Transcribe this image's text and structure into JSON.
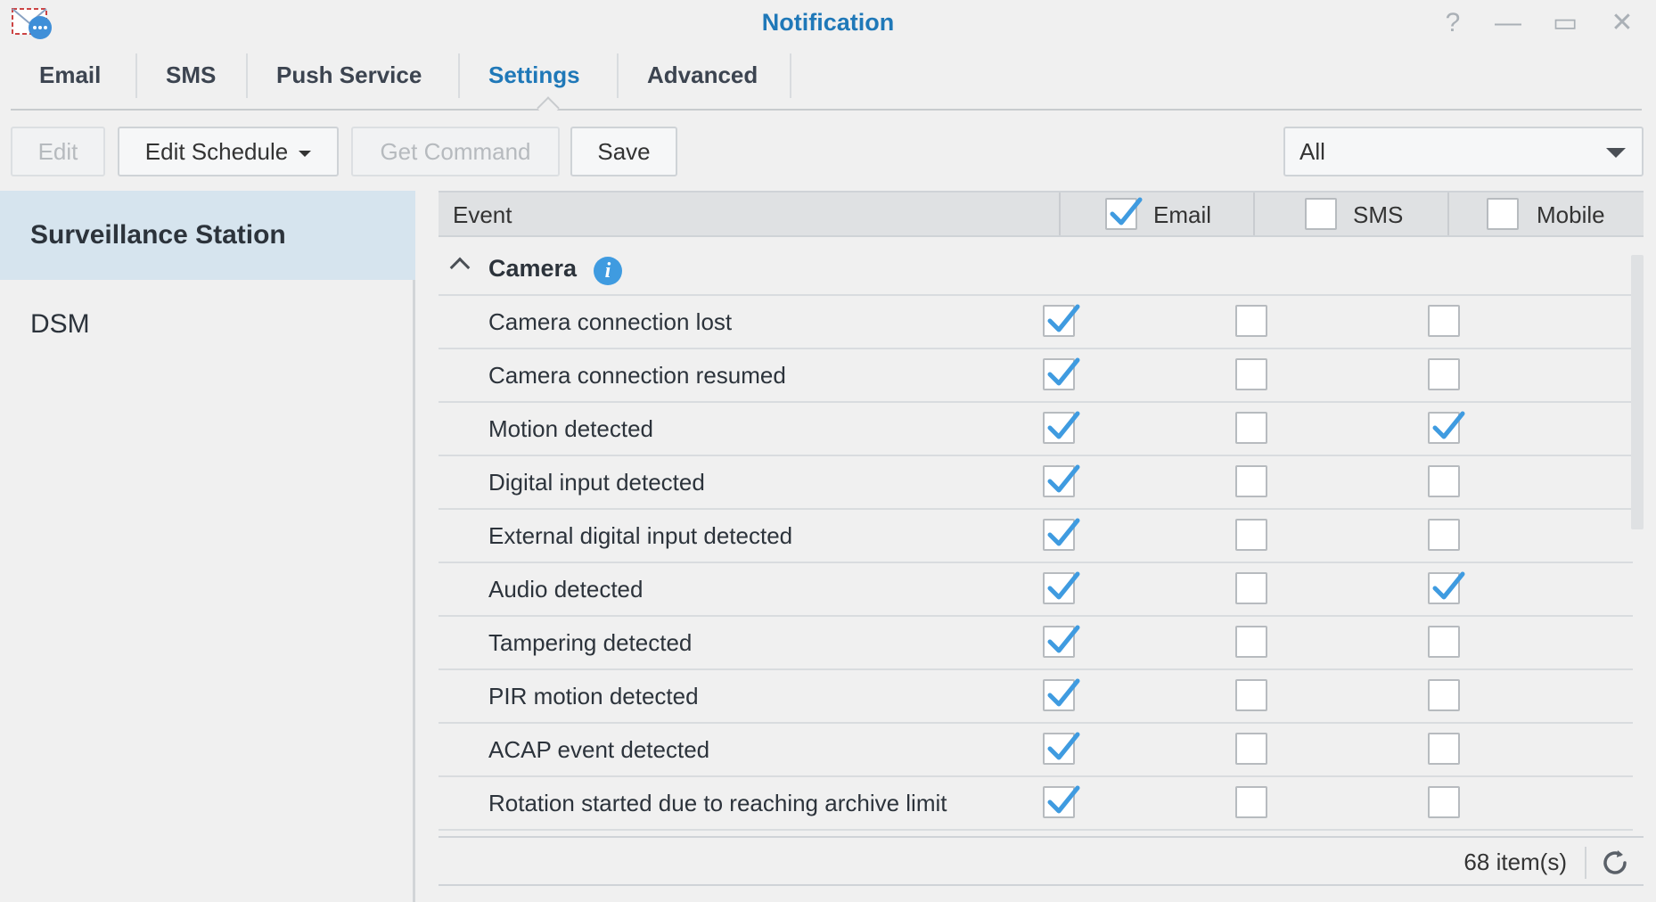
{
  "window": {
    "title": "Notification",
    "controls": {
      "help": "?",
      "minimize": "—",
      "maximize": "▭",
      "close": "✕"
    }
  },
  "tabs": [
    {
      "label": "Email",
      "active": false
    },
    {
      "label": "SMS",
      "active": false
    },
    {
      "label": "Push Service",
      "active": false
    },
    {
      "label": "Settings",
      "active": true
    },
    {
      "label": "Advanced",
      "active": false
    }
  ],
  "toolbar": {
    "edit_label": "Edit",
    "edit_schedule_label": "Edit Schedule",
    "get_command_label": "Get Command",
    "save_label": "Save",
    "filter_value": "All"
  },
  "sidebar": {
    "items": [
      {
        "label": "Surveillance Station",
        "active": true
      },
      {
        "label": "DSM",
        "active": false
      }
    ]
  },
  "grid": {
    "columns": {
      "event": "Event",
      "email": "Email",
      "sms": "SMS",
      "mobile": "Mobile"
    },
    "header_checks": {
      "email": true,
      "sms": false,
      "mobile": false
    },
    "group": {
      "label": "Camera",
      "info": "i"
    },
    "rows": [
      {
        "event": "Camera connection lost",
        "email": true,
        "sms": false,
        "mobile": false
      },
      {
        "event": "Camera connection resumed",
        "email": true,
        "sms": false,
        "mobile": false
      },
      {
        "event": "Motion detected",
        "email": true,
        "sms": false,
        "mobile": true
      },
      {
        "event": "Digital input detected",
        "email": true,
        "sms": false,
        "mobile": false
      },
      {
        "event": "External digital input detected",
        "email": true,
        "sms": false,
        "mobile": false
      },
      {
        "event": "Audio detected",
        "email": true,
        "sms": false,
        "mobile": true
      },
      {
        "event": "Tampering detected",
        "email": true,
        "sms": false,
        "mobile": false
      },
      {
        "event": "PIR motion detected",
        "email": true,
        "sms": false,
        "mobile": false
      },
      {
        "event": "ACAP event detected",
        "email": true,
        "sms": false,
        "mobile": false
      },
      {
        "event": "Rotation started due to reaching archive limit",
        "email": true,
        "sms": false,
        "mobile": false
      }
    ],
    "item_count": "68 item(s)"
  },
  "colors": {
    "accent": "#1f78b8",
    "check": "#3f9be0"
  },
  "icons": {
    "app": "notification-app-icon",
    "refresh": "refresh-icon",
    "info": "info-icon",
    "collapse": "chevron-up-icon"
  }
}
